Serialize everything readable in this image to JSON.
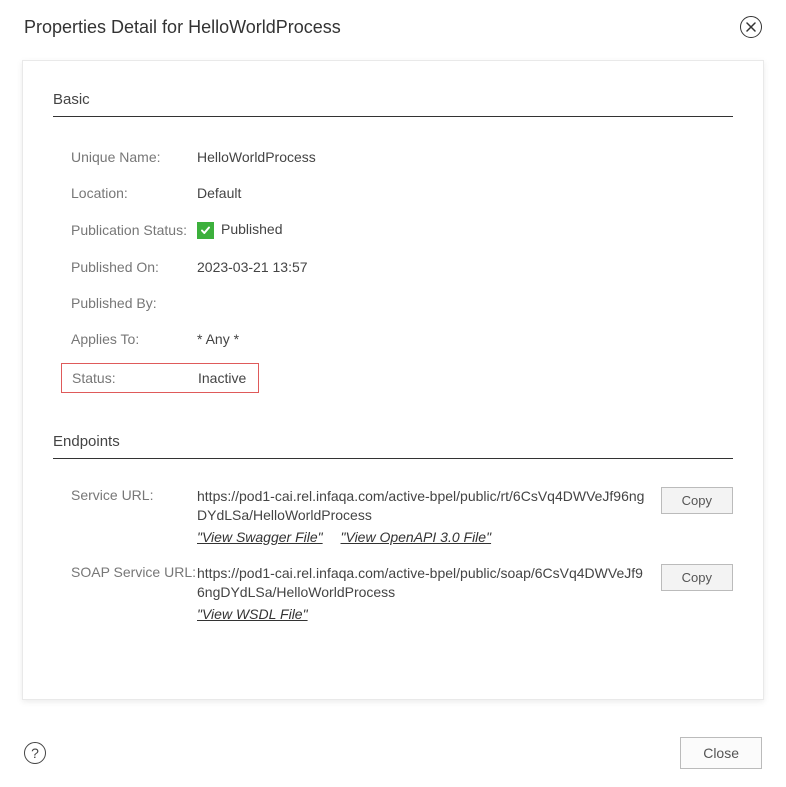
{
  "dialog": {
    "title": "Properties Detail for HelloWorldProcess"
  },
  "sections": {
    "basic_title": "Basic",
    "endpoints_title": "Endpoints"
  },
  "basic": {
    "unique_name_label": "Unique Name:",
    "unique_name_value": "HelloWorldProcess",
    "location_label": "Location:",
    "location_value": "Default",
    "publication_status_label": "Publication Status:",
    "publication_status_value": "Published",
    "published_on_label": "Published On:",
    "published_on_value": "2023-03-21 13:57",
    "published_by_label": "Published By:",
    "published_by_value": "",
    "applies_to_label": "Applies To:",
    "applies_to_value": "* Any *",
    "status_label": "Status:",
    "status_value": "Inactive"
  },
  "endpoints": {
    "service_url_label": "Service URL:",
    "service_url_value": "https://pod1-cai.rel.infaqa.com/active-bpel/public/rt/6CsVq4DWVeJf96ngDYdLSa/HelloWorldProcess",
    "view_swagger": "\"View Swagger File\"",
    "view_openapi": "\"View OpenAPI 3.0 File\"",
    "soap_url_label": "SOAP Service URL:",
    "soap_url_value": "https://pod1-cai.rel.infaqa.com/active-bpel/public/soap/6CsVq4DWVeJf96ngDYdLSa/HelloWorldProcess",
    "view_wsdl": "\"View WSDL File\""
  },
  "buttons": {
    "copy": "Copy",
    "close": "Close"
  },
  "colors": {
    "published_check_bg": "#3cb03c",
    "highlight_border": "#df5a5a"
  }
}
